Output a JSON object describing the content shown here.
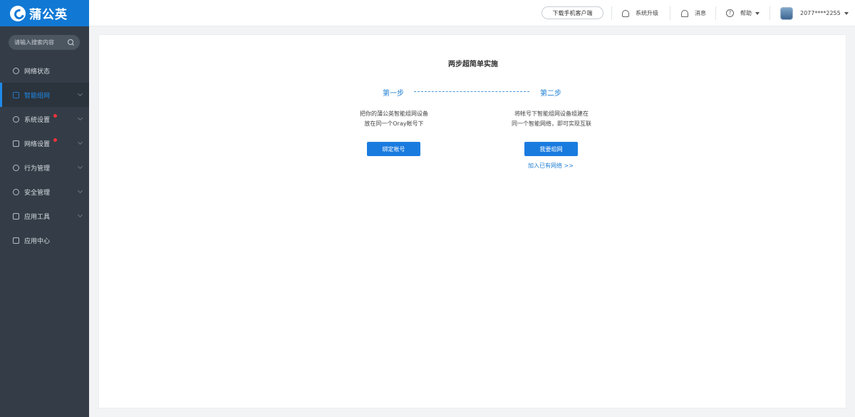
{
  "brand": {
    "name": "蒲公英"
  },
  "search": {
    "placeholder": "请输入搜索内容"
  },
  "sidebar": {
    "items": [
      {
        "label": "网络状态",
        "icon": "network-status-icon",
        "has_chevron": false,
        "badge": false
      },
      {
        "label": "智能组网",
        "icon": "smart-network-icon",
        "has_chevron": true,
        "badge": false,
        "active": true
      },
      {
        "label": "系统设置",
        "icon": "gear-icon",
        "has_chevron": true,
        "badge": true
      },
      {
        "label": "网络设置",
        "icon": "network-settings-icon",
        "has_chevron": true,
        "badge": true
      },
      {
        "label": "行为管理",
        "icon": "behavior-icon",
        "has_chevron": true,
        "badge": false
      },
      {
        "label": "安全管理",
        "icon": "shield-icon",
        "has_chevron": true,
        "badge": false
      },
      {
        "label": "应用工具",
        "icon": "toolbox-icon",
        "has_chevron": true,
        "badge": false
      },
      {
        "label": "应用中心",
        "icon": "app-center-icon",
        "has_chevron": false,
        "badge": false
      }
    ]
  },
  "header": {
    "download_label": "下载手机客户端",
    "upgrade_label": "系统升级",
    "messages_label": "消息",
    "help_label": "帮助",
    "account": "2077****2255"
  },
  "main": {
    "title": "两步超简单实施",
    "step1": {
      "label": "第一步",
      "line1": "把你的蒲公英智能组网设备",
      "line2": "放在同一个Oray帐号下",
      "button": "绑定帐号"
    },
    "step2": {
      "label": "第二步",
      "line1": "将帐号下智能组网设备组建在",
      "line2": "同一个智能网络，即可实现互联",
      "button": "我要组网",
      "link": "加入已有网络 >>"
    }
  },
  "colors": {
    "sidebar_bg": "#343d47",
    "brand_blue": "#1179d4",
    "accent": "#1a7bdf",
    "badge_red": "#f0323c"
  }
}
